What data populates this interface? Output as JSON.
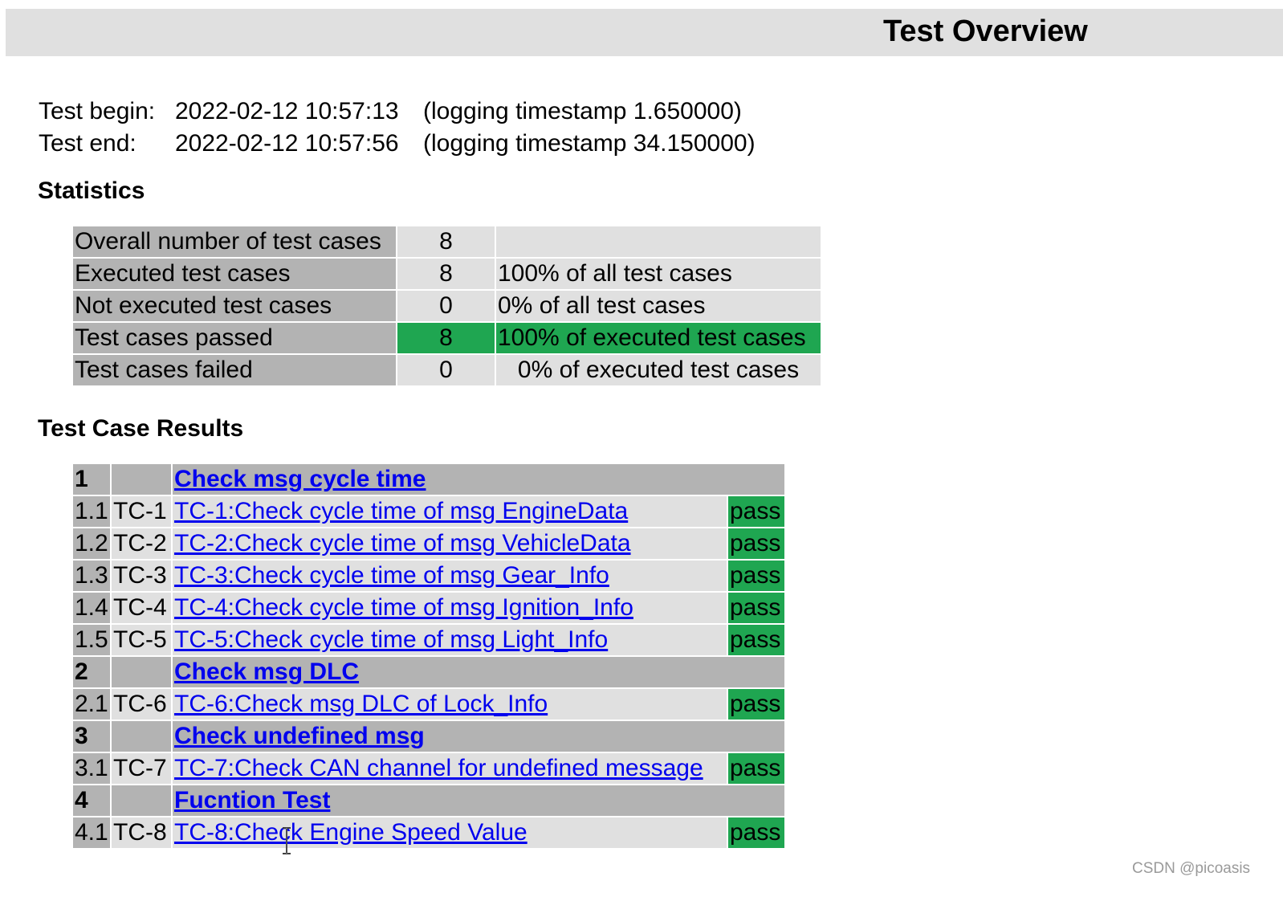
{
  "header": {
    "title": "Test Overview"
  },
  "times": {
    "begin_label": "Test begin:",
    "begin_value": "2022-02-12 10:57:13",
    "begin_ts": "(logging timestamp 1.650000)",
    "end_label": "Test end:",
    "end_value": "2022-02-12 10:57:56",
    "end_ts": "(logging timestamp 34.150000)"
  },
  "statistics": {
    "title": "Statistics",
    "rows": [
      {
        "label": "Overall number of test cases",
        "count": "8",
        "percent": ""
      },
      {
        "label": "Executed test cases",
        "count": "8",
        "percent": "100% of all test cases"
      },
      {
        "label": "Not executed test cases",
        "count": "0",
        "percent": "0% of all test cases"
      },
      {
        "label": "Test cases passed",
        "count": "8",
        "percent": "100% of executed test cases"
      },
      {
        "label": "Test cases failed",
        "count": "0",
        "percent": "0% of executed test cases"
      }
    ]
  },
  "results": {
    "title": "Test Case Results",
    "groups": [
      {
        "index": "1",
        "title": "Check msg cycle time"
      },
      {
        "index": "2",
        "title": "Check msg DLC"
      },
      {
        "index": "3",
        "title": "Check undefined msg"
      },
      {
        "index": "4",
        "title": "Fucntion Test"
      }
    ],
    "cases": [
      {
        "index": "1.1",
        "id": "TC-1",
        "title": "TC-1:Check cycle time of msg EngineData",
        "verdict": "pass"
      },
      {
        "index": "1.2",
        "id": "TC-2",
        "title": "TC-2:Check cycle time of msg VehicleData",
        "verdict": "pass"
      },
      {
        "index": "1.3",
        "id": "TC-3",
        "title": "TC-3:Check cycle time of msg Gear_Info",
        "verdict": "pass"
      },
      {
        "index": "1.4",
        "id": "TC-4",
        "title": "TC-4:Check cycle time of msg Ignition_Info",
        "verdict": "pass"
      },
      {
        "index": "1.5",
        "id": "TC-5",
        "title": "TC-5:Check cycle time of msg Light_Info",
        "verdict": "pass"
      },
      {
        "index": "2.1",
        "id": "TC-6",
        "title": "TC-6:Check msg DLC of Lock_Info",
        "verdict": "pass"
      },
      {
        "index": "3.1",
        "id": "TC-7",
        "title": "TC-7:Check CAN channel for undefined message",
        "verdict": "pass"
      },
      {
        "index": "4.1",
        "id": "TC-8",
        "title": "TC-8:Check Engine Speed Value",
        "verdict": "pass"
      }
    ]
  },
  "watermark": "CSDN @picoasis",
  "colors": {
    "pass_green": "#1fa651",
    "header_gray": "#b3b3b3",
    "cell_gray": "#e0e0e0",
    "link_blue": "#0000ee"
  }
}
